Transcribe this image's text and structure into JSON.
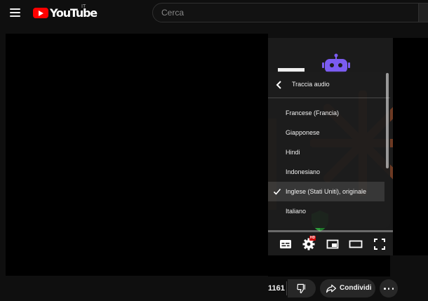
{
  "header": {
    "logo_text": "YouTube",
    "country_code": "IT",
    "search_placeholder": "Cerca"
  },
  "settings_panel": {
    "title": "Traccia audio",
    "items": [
      {
        "label": "Francese (Francia)",
        "selected": false
      },
      {
        "label": "Giapponese",
        "selected": false
      },
      {
        "label": "Hindi",
        "selected": false
      },
      {
        "label": "Indonesiano",
        "selected": false
      },
      {
        "label": "Inglese (Stati Uniti), originale",
        "selected": true
      },
      {
        "label": "Italiano",
        "selected": false
      }
    ]
  },
  "controls": {
    "quality_badge": "HD"
  },
  "actions": {
    "like_count": "1161",
    "share_label": "Condividi"
  },
  "colors": {
    "brand_red": "#ff0000",
    "background": "#0f0f0f",
    "accent_purple": "#7b5cf0",
    "shield_green": "#2e9e3c"
  }
}
